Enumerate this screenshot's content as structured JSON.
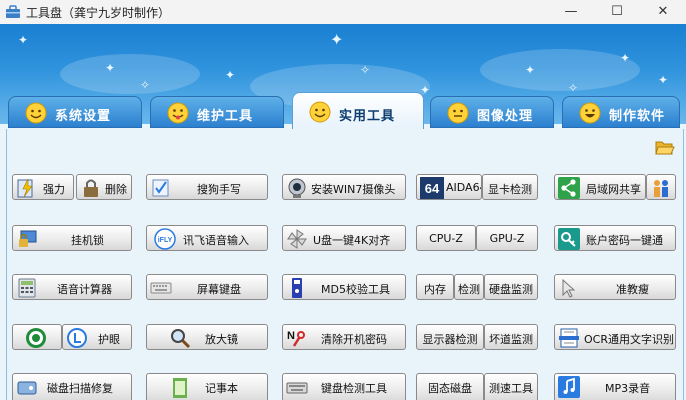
{
  "window": {
    "title": "工具盘（龚宁九岁时制作）",
    "minimize": "—",
    "maximize": "☐",
    "close": "✕"
  },
  "tabs": [
    {
      "label": "系统设置",
      "active": false
    },
    {
      "label": "维护工具",
      "active": false
    },
    {
      "label": "实用工具",
      "active": true
    },
    {
      "label": "图像处理",
      "active": false
    },
    {
      "label": "制作软件",
      "active": false
    }
  ],
  "buttons": {
    "qiangli": "强力",
    "shanchu": "删除",
    "sougou": "搜狗手写",
    "win7cam": "安装WIN7摄像头",
    "aida64": "AIDA64",
    "xianka": "显卡检测",
    "lan_share": "局域网共享",
    "guaji": "挂机锁",
    "xunfei": "讯飞语音输入",
    "udisk4k": "U盘一键4K对齐",
    "cpuz": "CPU-Z",
    "gpuz": "GPU-Z",
    "password": "账户密码一键通",
    "calc": "语音计算器",
    "screen_kb": "屏幕键盘",
    "md5": "MD5校验工具",
    "memory": "内存",
    "jiance": "检测",
    "disk_monitor": "硬盘监测",
    "zhunjiaoshou": "准教瘦",
    "huyan": "护眼",
    "magnifier": "放大镜",
    "clear_pwd": "清除开机密码",
    "monitor_test": "显示器检测",
    "hwmonitor": "坏道监测",
    "ocr": "OCR通用文字识别",
    "disk_scan": "磁盘扫描修复",
    "notepad": "记事本",
    "kb_test": "键盘检测工具",
    "ssd": "固态磁盘",
    "speed": "测速工具",
    "mp3": "MP3录音"
  },
  "icons": {
    "app": "toolbox-icon",
    "tab": "smiley-icon",
    "folder": "open-folder-icon"
  },
  "colors": {
    "accent": "#2c80cf",
    "active_tab_text": "#0c3d6e",
    "sky_top": "#1b7fd2"
  }
}
